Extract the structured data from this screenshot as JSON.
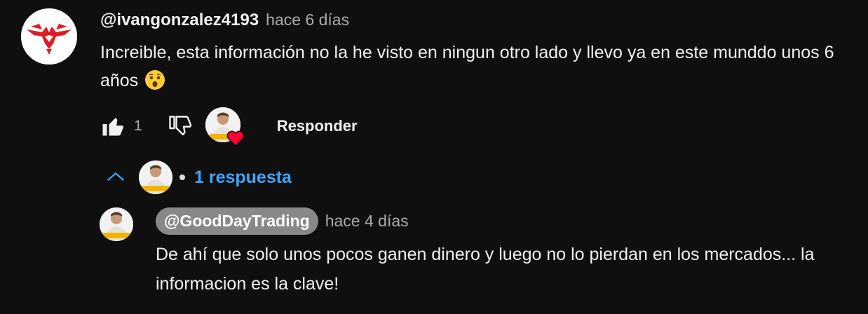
{
  "comment": {
    "author": "@ivangonzalez4193",
    "time": "hace 6 días",
    "text": "Increible, esta información no la he visto en ningun otro lado y llevo ya en este munddo unos 6 años",
    "emoji": "astonished-face",
    "like_count": "1",
    "reply_label": "Responder"
  },
  "replies_toggle": {
    "label": "1 respuesta"
  },
  "reply": {
    "author": "@GoodDayTrading",
    "time": "hace 4 días",
    "text": "De ahí que solo unos pocos ganen dinero y luego no lo pierdan en los mercados... la informacion es la clave!"
  },
  "colors": {
    "background": "#0f0f0f",
    "link_blue": "#3ea6ff",
    "heart_red": "#ff0033",
    "author_chip": "#888888"
  },
  "icons": {
    "like": "thumbs-up-filled-icon",
    "dislike": "thumbs-down-outline-icon",
    "collapse": "chevron-up-icon",
    "creator_heart": "heart-icon"
  }
}
